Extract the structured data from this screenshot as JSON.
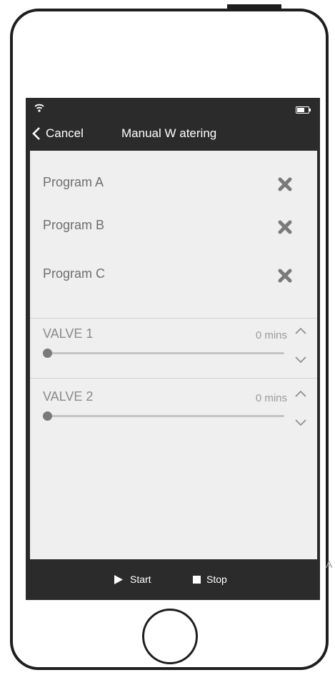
{
  "status_bar": {
    "wifi_icon": "wifi-icon",
    "battery_icon": "battery-icon"
  },
  "nav": {
    "back_label": "Cancel",
    "title": "Manual W atering"
  },
  "programs": [
    {
      "label": "Program A",
      "icon": "close-icon"
    },
    {
      "label": "Program B",
      "icon": "close-icon"
    },
    {
      "label": "Program C",
      "icon": "close-icon"
    }
  ],
  "valves": [
    {
      "label": "VALVE 1",
      "duration": "0 mins",
      "level": 0
    },
    {
      "label": "VALVE 2",
      "duration": "0 mins",
      "level": 0
    }
  ],
  "footer": {
    "start_label": "Start",
    "stop_label": "Stop"
  },
  "stray_text": "A",
  "colors": {
    "bar_background": "#2b2b2b",
    "content_background": "#efefef",
    "text_primary": "#6e6e6e",
    "text_secondary": "#9a9a9a"
  }
}
